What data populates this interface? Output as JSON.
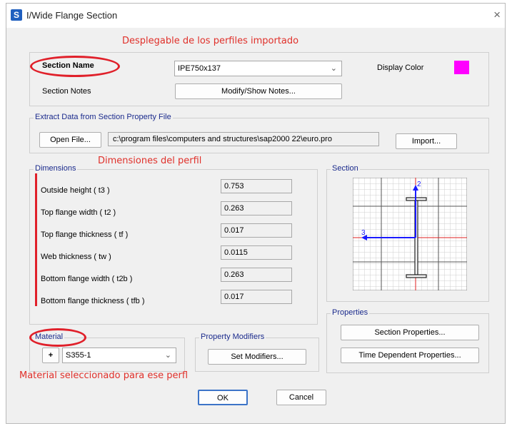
{
  "window": {
    "title": "I/Wide Flange Section",
    "icon_letter": "S",
    "close_glyph": "×"
  },
  "annotations": {
    "dropdown_note": "Desplegable de los perfiles importado",
    "dimensions_note": "Dimensiones del perfil",
    "material_note": "Material seleccionado para ese perfl"
  },
  "section": {
    "name_label": "Section Name",
    "name_value": "IPE750x137",
    "display_color_label": "Display Color",
    "display_color": "#ff00ff",
    "notes_label": "Section Notes",
    "notes_button": "Modify/Show Notes..."
  },
  "extract": {
    "group_label": "Extract Data from Section Property File",
    "open_button": "Open File...",
    "file_path": "c:\\program files\\computers and structures\\sap2000 22\\euro.pro",
    "import_button": "Import..."
  },
  "dimensions": {
    "group_label": "Dimensions",
    "rows": [
      {
        "label": "Outside height  ( t3 )",
        "value": "0.753"
      },
      {
        "label": "Top flange width  ( t2 )",
        "value": "0.263"
      },
      {
        "label": "Top flange thickness  ( tf )",
        "value": "0.017"
      },
      {
        "label": "Web thickness  ( tw )",
        "value": "0.0115"
      },
      {
        "label": "Bottom flange width  ( t2b )",
        "value": "0.263"
      },
      {
        "label": "Bottom flange thickness  ( tfb )",
        "value": "0.017"
      }
    ]
  },
  "preview": {
    "group_label": "Section",
    "axis_2": "2",
    "axis_3": "3"
  },
  "properties": {
    "group_label": "Properties",
    "section_button": "Section Properties...",
    "time_button": "Time Dependent Properties..."
  },
  "material": {
    "group_label": "Material",
    "plus": "+",
    "value": "S355-1"
  },
  "modifiers": {
    "group_label": "Property Modifiers",
    "button": "Set Modifiers..."
  },
  "footer": {
    "ok": "OK",
    "cancel": "Cancel"
  },
  "colors": {
    "annotation_red": "#e0202a",
    "axis_blue": "#1a1aff",
    "axis_red": "#e02020",
    "label_blue": "#1a2a8c"
  }
}
